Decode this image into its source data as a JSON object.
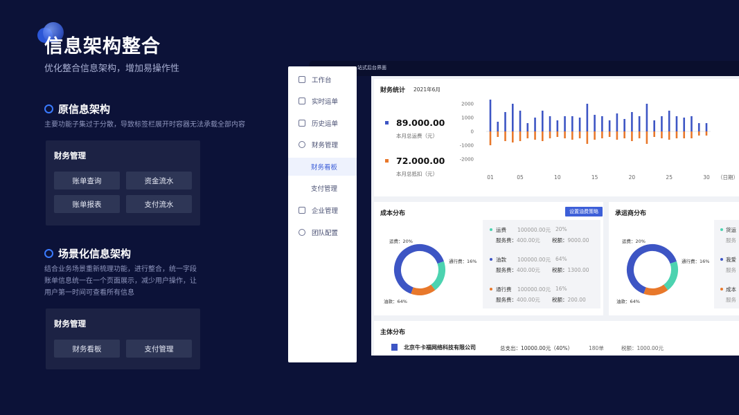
{
  "page": {
    "title": "信息架构整合",
    "subtitle": "优化整合信息架构，增加易操作性"
  },
  "section_original": {
    "title": "原信息架构",
    "desc": "主要功能子集过于分散，导致标签栏展开时容器无法承载全部内容",
    "card_title": "财务管理",
    "chips": [
      "账单查询",
      "资金流水",
      "账单报表",
      "支付流水"
    ]
  },
  "section_scene": {
    "title": "场景化信息架构",
    "desc_lines": [
      "结合业务场景重新梳理功能，进行整合，统一字段",
      "账单信息统一在一个页面展示，减少用户操作，让",
      "用户第一时间可查看所有信息"
    ],
    "card_title": "财务管理",
    "chips": [
      "财务看板",
      "支付管理"
    ]
  },
  "app": {
    "topbar_text": "站式后台界面",
    "nav": [
      {
        "label": "工作台",
        "icon": "layers-icon"
      },
      {
        "label": "实时运单",
        "icon": "document-icon"
      },
      {
        "label": "历史运单",
        "icon": "history-icon"
      },
      {
        "label": "财务管理",
        "icon": "finance-icon"
      },
      {
        "label": "财务看板",
        "icon": "",
        "sub": true,
        "active": true
      },
      {
        "label": "支付管理",
        "icon": "",
        "sub": true
      },
      {
        "label": "企业管理",
        "icon": "building-icon"
      },
      {
        "label": "团队配置",
        "icon": "team-icon"
      }
    ],
    "finance": {
      "title": "财务统计",
      "date": "2021年6月",
      "freight_value": "89.000.00",
      "freight_label": "本月总运费（元）",
      "deduct_value": "72.000.00",
      "deduct_label": "本月总抵扣（元）"
    },
    "cost": {
      "title": "成本分布",
      "button": "设置油费策略",
      "donut_labels": [
        "运费：20%",
        "通行费：16%",
        "油款：64%"
      ],
      "items": [
        {
          "name": "运费",
          "amount": "100000.00元",
          "pct": "20%",
          "fee_label": "服务费：",
          "fee": "400.00元",
          "tax_label": "税额：",
          "tax": "9000.00"
        },
        {
          "name": "油款",
          "amount": "100000.00元",
          "pct": "64%",
          "fee_label": "服务费：",
          "fee": "400.00元",
          "tax_label": "税额：",
          "tax": "1300.00"
        },
        {
          "name": "通行费",
          "amount": "100000.00元",
          "pct": "16%",
          "fee_label": "服务费：",
          "fee": "400.00元",
          "tax_label": "税额：",
          "tax": "200.00"
        }
      ]
    },
    "carrier": {
      "title": "承运商分布",
      "donut_labels": [
        "运费：20%",
        "通行费：16%",
        "油款：64%"
      ],
      "items": [
        "货运",
        "服务",
        "我爱",
        "服务",
        "成本",
        "服务"
      ]
    },
    "subject": {
      "title": "主体分布",
      "company": "北京牛卡福网络科技有限公司",
      "total": "总支出：10000.00元（40%）",
      "orders": "180单",
      "tax": "税额：1000.00元"
    },
    "colors": {
      "blue": "#3d55c4",
      "orange": "#e8782b",
      "teal": "#4cd3b0",
      "bg": "#0c1238",
      "accent": "#3a7bff"
    }
  },
  "chart_data": {
    "type": "bar",
    "x": [
      1,
      2,
      3,
      4,
      5,
      6,
      7,
      8,
      9,
      10,
      11,
      12,
      13,
      14,
      15,
      16,
      17,
      18,
      19,
      20,
      21,
      22,
      23,
      24,
      25,
      26,
      27,
      28,
      29,
      30
    ],
    "xtick_labels": [
      "01",
      "05",
      "10",
      "15",
      "20",
      "25",
      "30"
    ],
    "xtick_values": [
      1,
      5,
      10,
      15,
      20,
      25,
      30
    ],
    "xlabel": "（日期）",
    "ylim": [
      -2000,
      2000
    ],
    "yticks": [
      2000,
      1000,
      0,
      -1000,
      -2000
    ],
    "grid": false,
    "series": [
      {
        "values": [
          2300,
          700,
          1400,
          2000,
          1500,
          600,
          1000,
          1500,
          1100,
          800,
          1100,
          1100,
          1000,
          2000,
          1200,
          1100,
          800,
          1300,
          900,
          1400,
          1100,
          2000,
          800,
          1100,
          1500,
          1100,
          1000,
          1100,
          600,
          600
        ]
      },
      {
        "values": [
          -1000,
          -400,
          -700,
          -800,
          -700,
          -500,
          -600,
          -700,
          -500,
          -400,
          -500,
          -600,
          -500,
          -900,
          -600,
          -500,
          -400,
          -600,
          -500,
          -700,
          -500,
          -900,
          -400,
          -500,
          -600,
          -500,
          -500,
          -500,
          -300,
          -300
        ]
      }
    ]
  }
}
